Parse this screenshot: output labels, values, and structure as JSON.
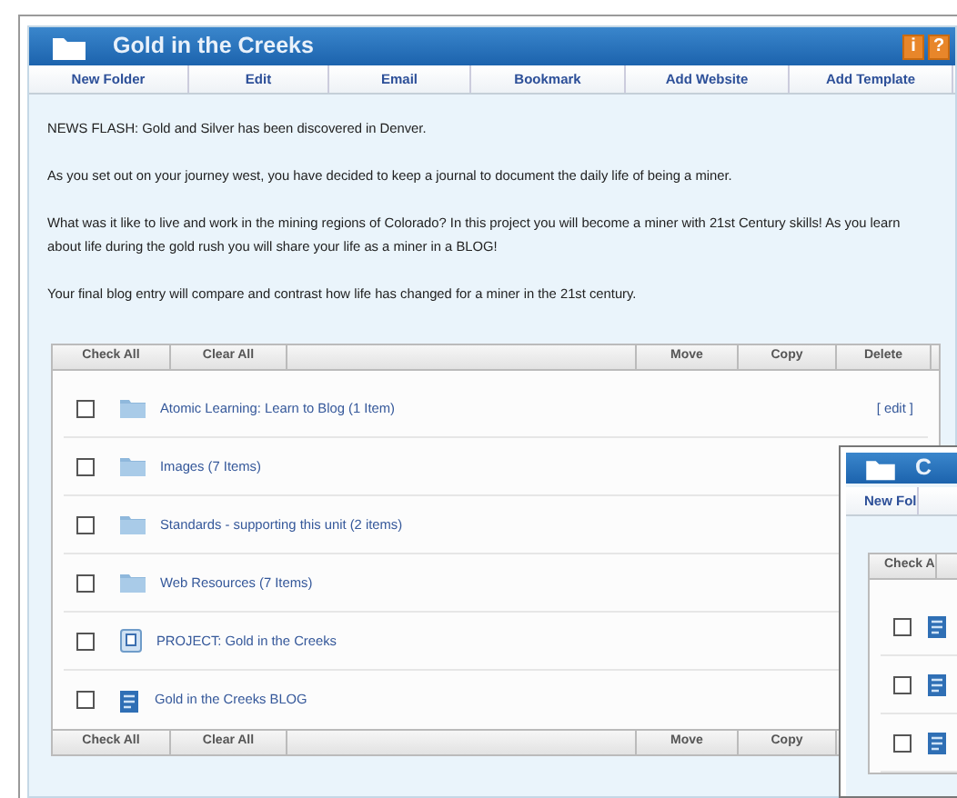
{
  "window": {
    "title": "Gold in the Creeks",
    "title_buttons": [
      "i",
      "?"
    ],
    "toolbar": [
      "New Folder",
      "Edit",
      "Email",
      "Bookmark",
      "Add Website",
      "Add Template"
    ],
    "paragraphs": [
      "NEWS FLASH: Gold and Silver has been discovered in Denver.",
      "As you set out on your journey west, you have decided to keep a journal to document the daily life of being a miner.",
      "What was it like to live and work in the mining regions of Colorado? In this project you will become a miner with 21st Century skills! As you learn about life during the gold rush you will share your life as a miner in a BLOG!",
      "Your final blog entry will compare and contrast how life has changed for a miner in the 21st century."
    ],
    "list": {
      "top_actions": [
        "Check All",
        "Clear All",
        "Move",
        "Copy",
        "Delete"
      ],
      "items": [
        {
          "kind": "folder",
          "label": "Atomic Learning: Learn to Blog (1 Item)",
          "checked": false,
          "edit_link": "[ edit ]"
        },
        {
          "kind": "folder",
          "label": "Images (7 Items)",
          "checked": false
        },
        {
          "kind": "folder",
          "label": "Standards - supporting this unit (2 items)",
          "checked": false
        },
        {
          "kind": "folder",
          "label": "Web Resources (7 Items)",
          "checked": false
        },
        {
          "kind": "project",
          "label": "PROJECT: Gold in the Creeks",
          "checked": false
        },
        {
          "kind": "blog",
          "label": "Gold in the Creeks BLOG",
          "checked": false
        }
      ],
      "bottom_actions": [
        "Check All",
        "Clear All",
        "Move",
        "Copy"
      ]
    }
  },
  "second_window": {
    "title": "C",
    "toolbar": [
      "New Fol"
    ],
    "actions": [
      "Check A"
    ],
    "items": [
      {
        "kind": "blog",
        "checked": false
      },
      {
        "kind": "blog",
        "checked": false
      },
      {
        "kind": "blog",
        "checked": false
      }
    ]
  }
}
